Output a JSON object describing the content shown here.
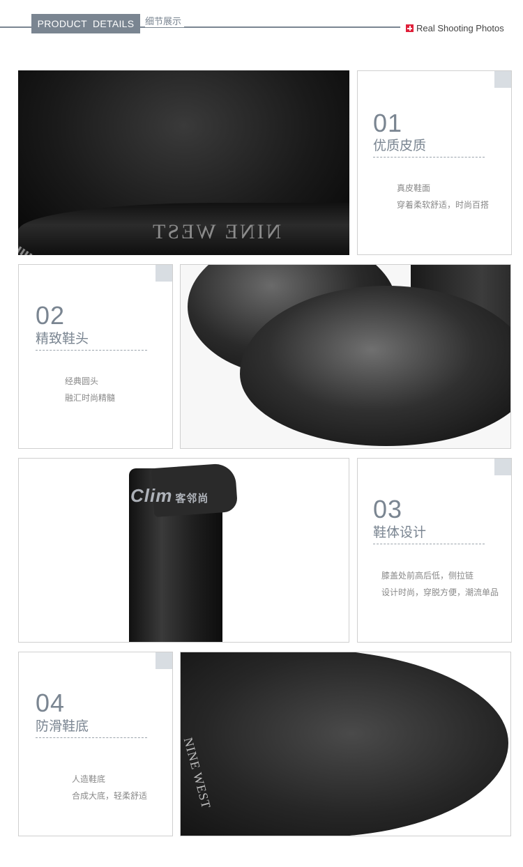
{
  "header": {
    "product": "PRODUCT",
    "details": "DETAILS",
    "section_cn": "细节展示",
    "real_label": "Real Shooting Photos"
  },
  "photos": {
    "leather_logo": "NINE WEST",
    "watermark_brand": "Clim",
    "watermark_cn": "客邻尚",
    "sole_logo": "NINE WEST"
  },
  "details": [
    {
      "num": "01",
      "title": "优质皮质",
      "line1": "真皮鞋面",
      "line2": "穿着柔软舒适，时尚百搭"
    },
    {
      "num": "02",
      "title": "精致鞋头",
      "line1": "经典圆头",
      "line2": "融汇时尚精髓"
    },
    {
      "num": "03",
      "title": "鞋体设计",
      "line1": "膝盖处前高后低，侧拉链",
      "line2": "设计时尚，穿脱方便，潮流单品"
    },
    {
      "num": "04",
      "title": "防滑鞋底",
      "line1": "人造鞋底",
      "line2": "合成大底，轻柔舒适"
    }
  ],
  "colors": {
    "accent": "#7a8591",
    "plus_red": "#e0203a"
  }
}
